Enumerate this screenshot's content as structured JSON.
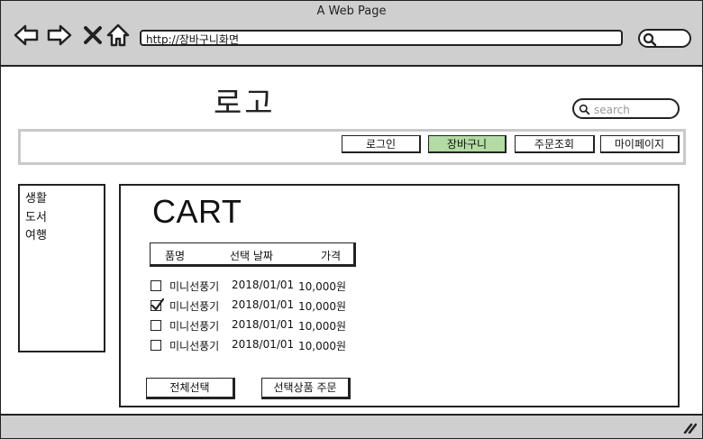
{
  "window": {
    "title": "A Web Page"
  },
  "browser": {
    "url": "http://장바구니화면",
    "icons": [
      "back-arrow-icon",
      "forward-arrow-icon",
      "close-x-icon",
      "home-icon",
      "search-icon"
    ]
  },
  "header": {
    "logo": "로고",
    "search_placeholder": "search"
  },
  "nav": {
    "items": [
      {
        "label": "로그인"
      },
      {
        "label": "장바구니",
        "active": true
      },
      {
        "label": "주문조회"
      },
      {
        "label": "마이페이지"
      }
    ],
    "active_color": "#b3dba4"
  },
  "sidebar": {
    "items": [
      {
        "label": "생활"
      },
      {
        "label": "도서"
      },
      {
        "label": "여행"
      }
    ]
  },
  "cart": {
    "title": "CART",
    "columns": [
      "품명",
      "선택 날짜",
      "가격"
    ],
    "rows": [
      {
        "checked": false,
        "name": "미니선풍기",
        "date": "2018/01/01",
        "price": "10,000원"
      },
      {
        "checked": true,
        "name": "미니선풍기",
        "date": "2018/01/01",
        "price": "10,000원"
      },
      {
        "checked": false,
        "name": "미니선풍기",
        "date": "2018/01/01",
        "price": "10,000원"
      },
      {
        "checked": false,
        "name": "미니선풍기",
        "date": "2018/01/01",
        "price": "10,000원"
      }
    ],
    "select_all_label": "전체선택",
    "order_selected_label": "선택상품 주문"
  }
}
